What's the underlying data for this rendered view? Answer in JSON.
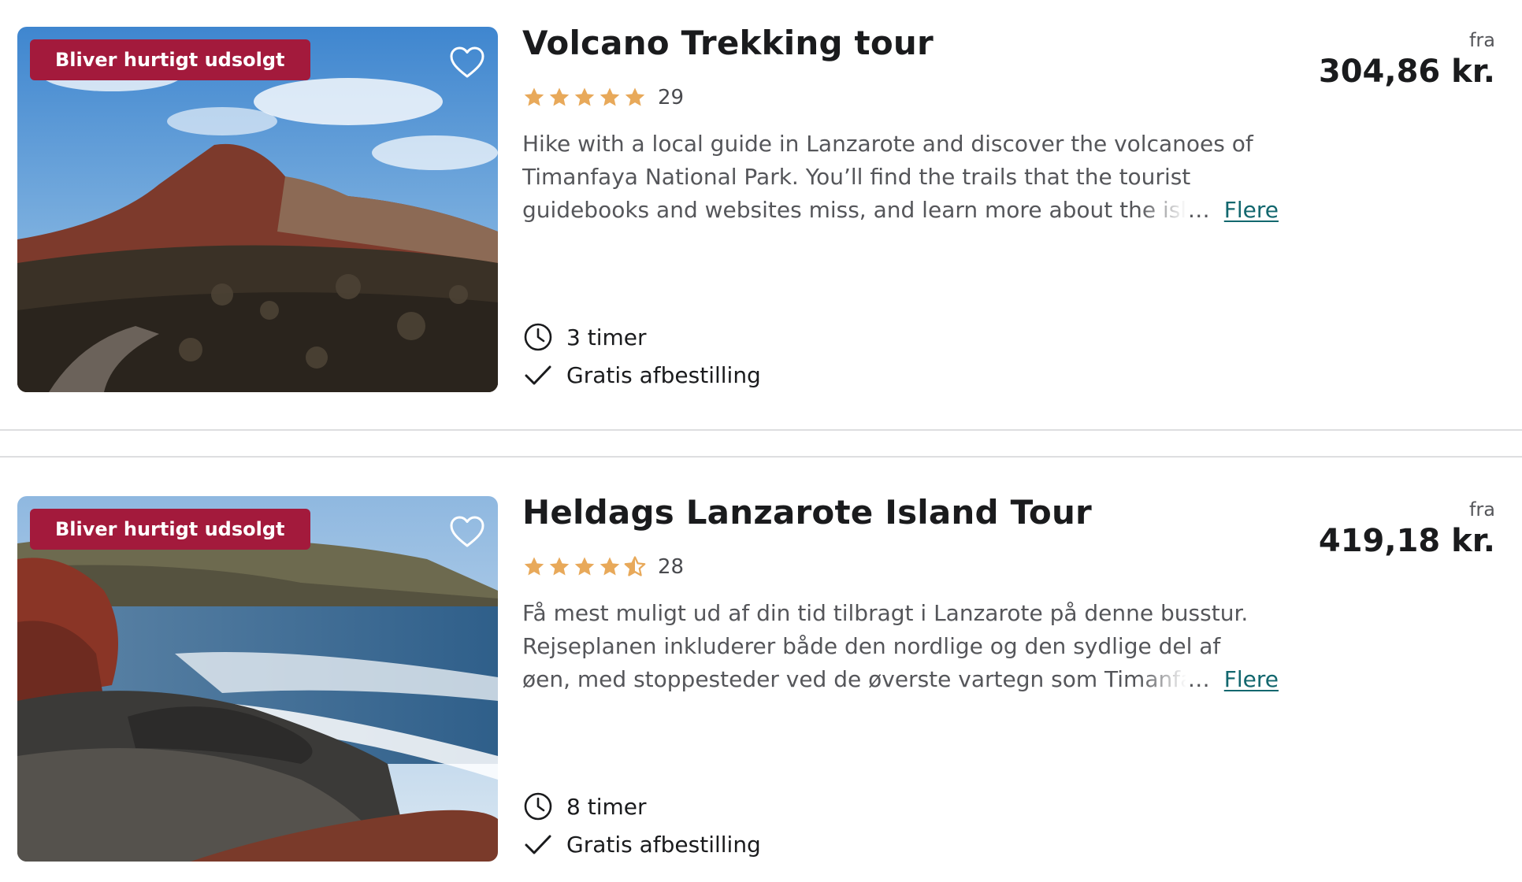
{
  "tours": [
    {
      "badge": "Bliver hurtigt udsolgt",
      "title": "Volcano Trekking tour",
      "rating": 5,
      "reviews": "29",
      "description_lines": [
        "Hike with a local guide in Lanzarote and discover the volcanoes of",
        "Timanfaya National Park. You’ll find the trails that the tourist",
        "guidebooks and websites miss, and learn more about the island"
      ],
      "ellipsis": "…",
      "more_label": "Flere",
      "duration": "3 timer",
      "cancellation": "Gratis afbestilling",
      "from_label": "fra",
      "price": "304,86 kr."
    },
    {
      "badge": "Bliver hurtigt udsolgt",
      "title": "Heldags Lanzarote Island Tour",
      "rating": 4.5,
      "reviews": "28",
      "description_lines": [
        "Få mest muligt ud af din tid tilbragt i Lanzarote på denne busstur.",
        "Rejseplanen inkluderer både den nordlige og den sydlige del af",
        "øen, med stoppesteder ved de øverste vartegn som Timanfaya"
      ],
      "ellipsis": "…",
      "more_label": "Flere",
      "duration": "8 timer",
      "cancellation": "Gratis afbestilling",
      "from_label": "fra",
      "price": "419,18 kr."
    }
  ],
  "colors": {
    "badge_bg": "#a31a3c",
    "star": "#e8a95a",
    "link": "#12676e",
    "text_primary": "#1a1b1d",
    "text_secondary": "#55565a",
    "divider": "#dddee0"
  },
  "icons": {
    "favorite": "heart-outline-icon",
    "duration": "clock-icon",
    "cancellation": "checkmark-icon",
    "rating": "star-icon"
  }
}
